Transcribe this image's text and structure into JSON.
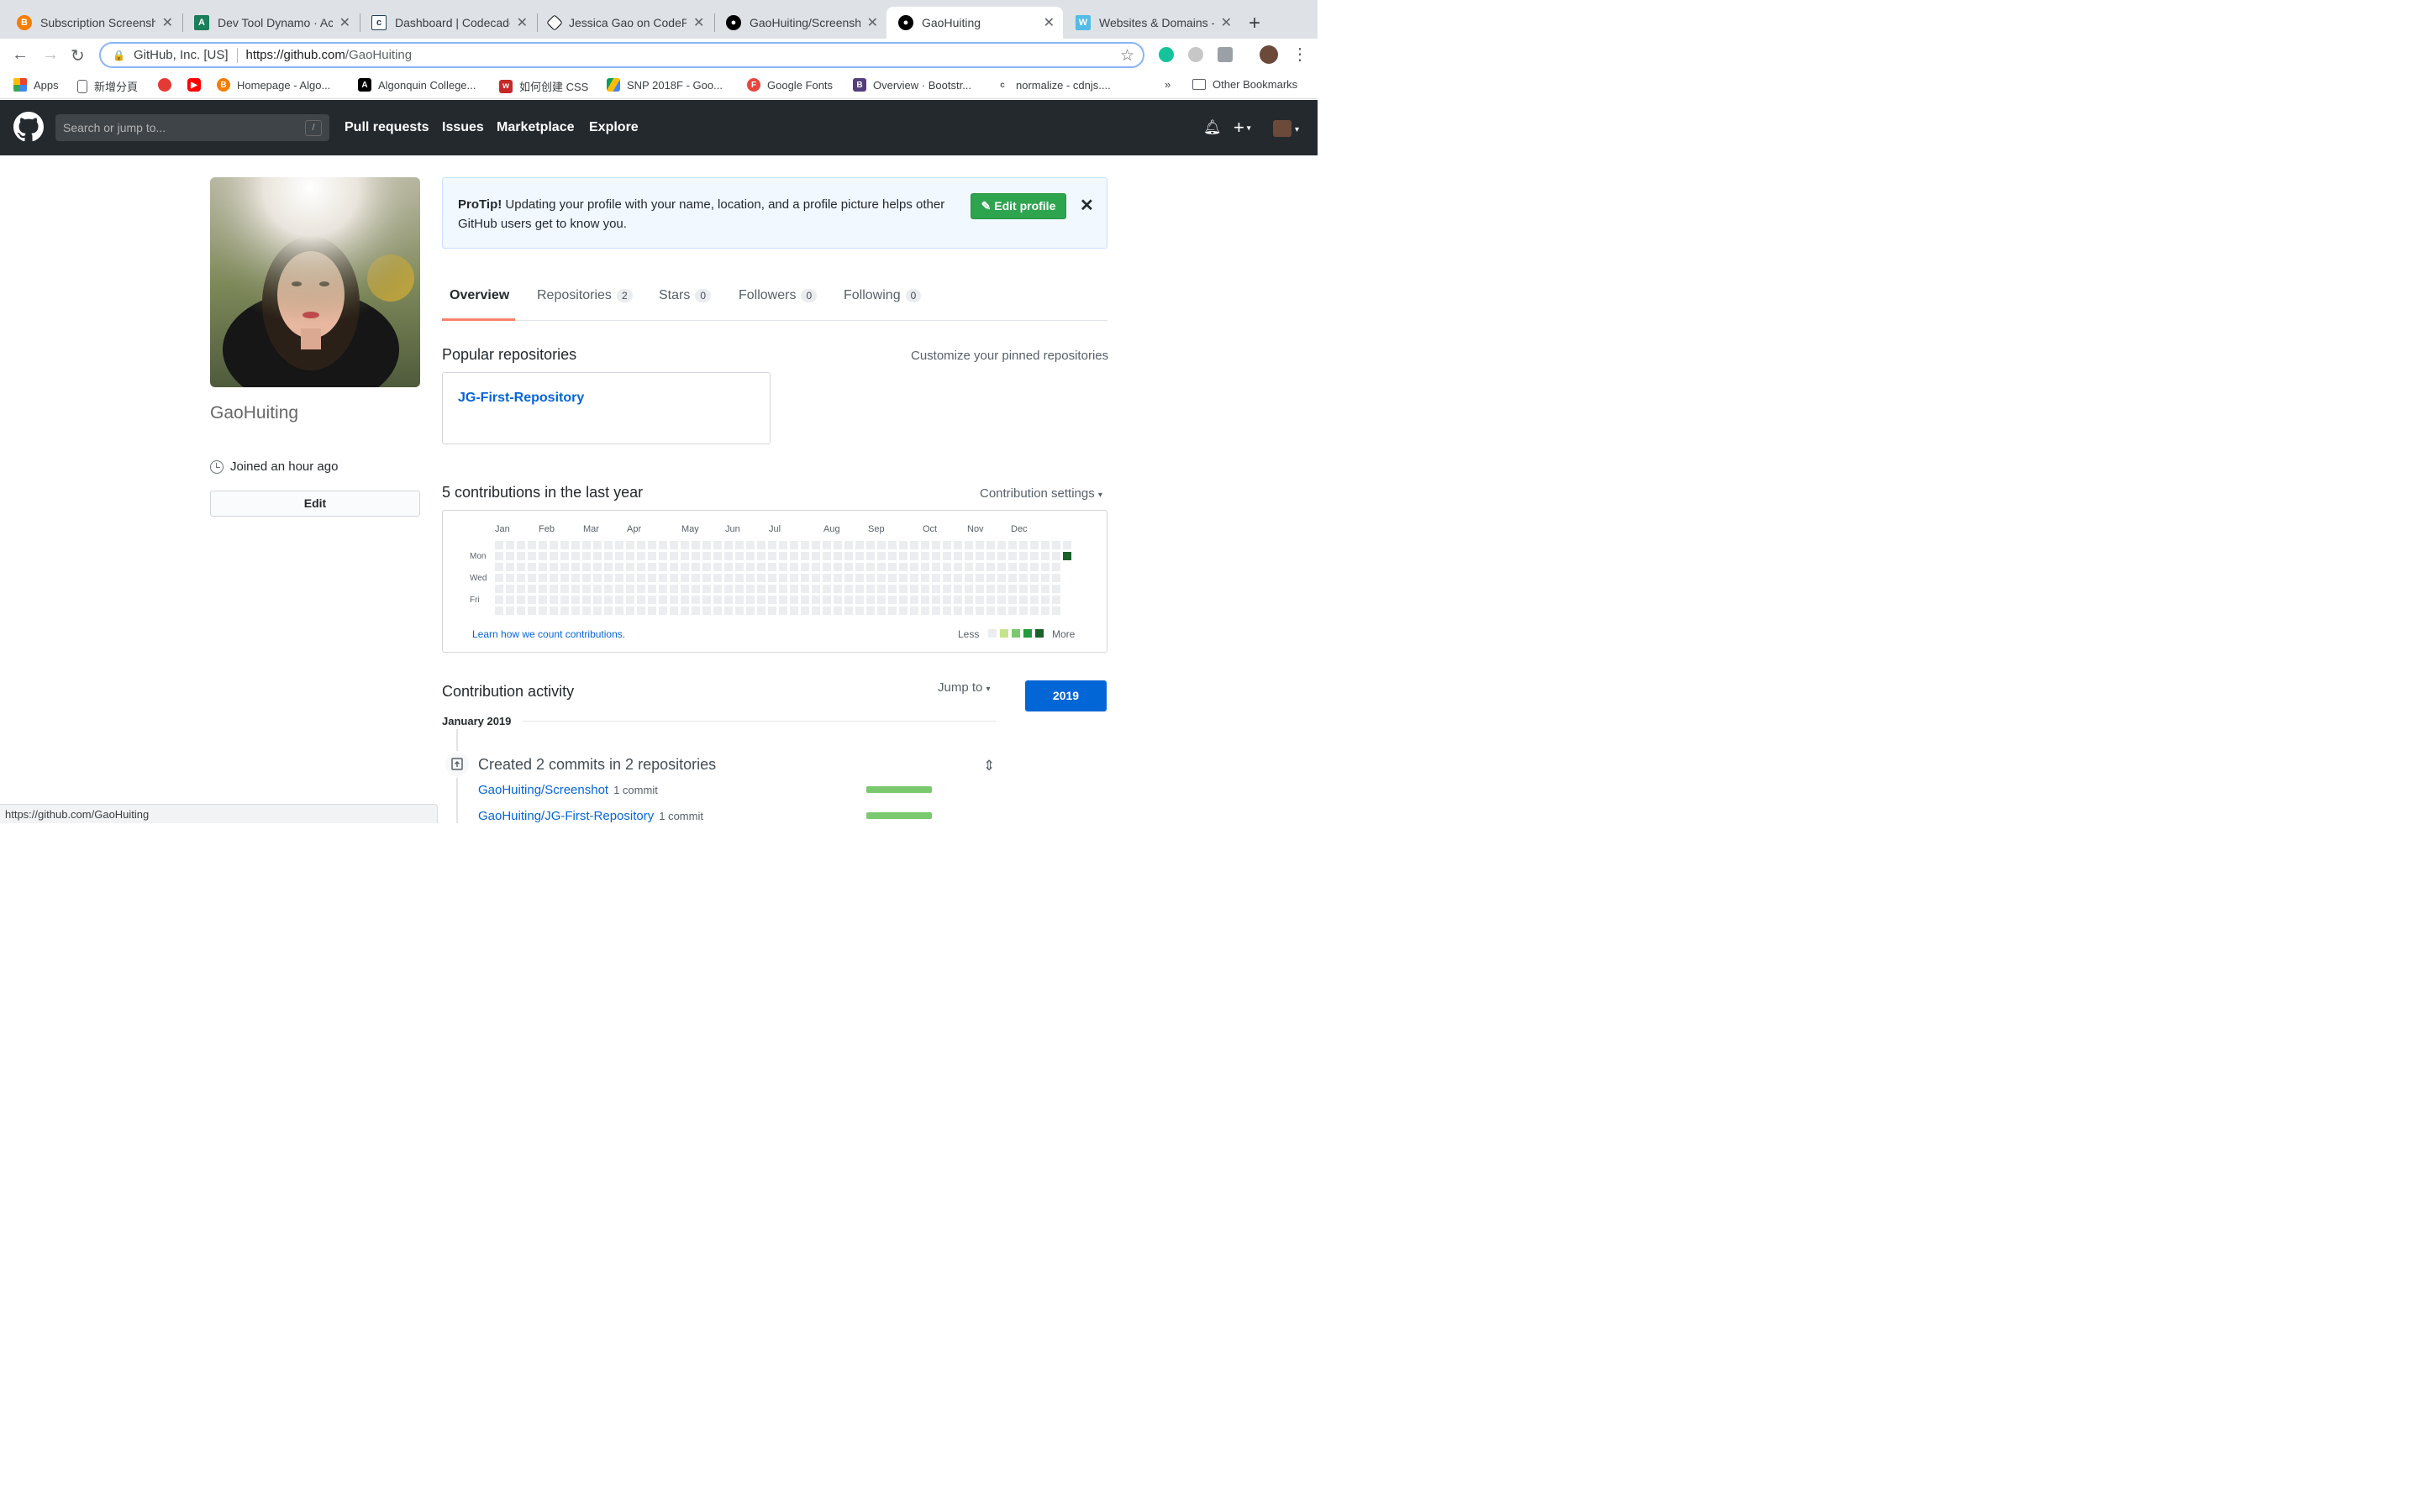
{
  "browser": {
    "tabs": [
      {
        "title": "Subscription Screensh",
        "icon": "blogger-icon",
        "color": "#f57d00"
      },
      {
        "title": "Dev Tool Dynamo · Act",
        "icon": "chart-icon",
        "color": "#1a7f5a"
      },
      {
        "title": "Dashboard | Codecade",
        "icon": "codecademy-icon",
        "color": "#204056"
      },
      {
        "title": "Jessica Gao on CodeP",
        "icon": "codepen-icon",
        "color": "#000000"
      },
      {
        "title": "GaoHuiting/Screensho",
        "icon": "github-icon",
        "color": "#000000"
      },
      {
        "title": "GaoHuiting",
        "icon": "github-icon",
        "color": "#000000",
        "active": true
      },
      {
        "title": "Websites & Domains -",
        "icon": "plesk-icon",
        "color": "#52bbe6"
      }
    ],
    "address": {
      "org": "GitHub, Inc. [US]",
      "url_host": "https://github.com",
      "url_path": "/GaoHuiting"
    },
    "bookmarks": [
      {
        "label": "Apps",
        "icon": "apps-grid-icon"
      },
      {
        "label": "新增分頁",
        "icon": "page-icon"
      },
      {
        "label": "",
        "icon": "kiwi-icon"
      },
      {
        "label": "",
        "icon": "youtube-icon"
      },
      {
        "label": "Homepage - Algo...",
        "icon": "blogger-icon"
      },
      {
        "label": "Algonquin College...",
        "icon": "algonquin-icon"
      },
      {
        "label": "如何创建 CSS",
        "icon": "w3-icon"
      },
      {
        "label": "SNP 2018F - Goo...",
        "icon": "drive-icon"
      },
      {
        "label": "Google Fonts",
        "icon": "fonts-icon"
      },
      {
        "label": "Overview · Bootstr...",
        "icon": "bootstrap-icon"
      },
      {
        "label": "normalize - cdnjs....",
        "icon": "cdnjs-icon"
      },
      {
        "label": "»",
        "icon": ""
      },
      {
        "label": "Other Bookmarks",
        "icon": "folder-icon"
      }
    ],
    "status_url": "https://github.com/GaoHuiting"
  },
  "github": {
    "search_placeholder": "Search or jump to...",
    "search_key": "/",
    "nav": [
      "Pull requests",
      "Issues",
      "Marketplace",
      "Explore"
    ]
  },
  "profile": {
    "username": "GaoHuiting",
    "joined": "Joined an hour ago",
    "edit_label": "Edit"
  },
  "protip": {
    "strong": "ProTip!",
    "text": " Updating your profile with your name, location, and a profile picture helps other GitHub users get to know you.",
    "button": "Edit profile"
  },
  "tabs": [
    {
      "label": "Overview",
      "count": null,
      "active": true
    },
    {
      "label": "Repositories",
      "count": "2"
    },
    {
      "label": "Stars",
      "count": "0"
    },
    {
      "label": "Followers",
      "count": "0"
    },
    {
      "label": "Following",
      "count": "0"
    }
  ],
  "popular": {
    "title": "Popular repositories",
    "customize": "Customize your pinned repositories",
    "repos": [
      "JG-First-Repository"
    ]
  },
  "contributions": {
    "title": "5 contributions in the last year",
    "settings": "Contribution settings",
    "months": [
      "Jan",
      "Feb",
      "Mar",
      "Apr",
      "May",
      "Jun",
      "Jul",
      "Aug",
      "Sep",
      "Oct",
      "Nov",
      "Dec"
    ],
    "days": [
      "Mon",
      "Wed",
      "Fri"
    ],
    "learn": "Learn how we count contributions.",
    "less": "Less",
    "more": "More",
    "colors": [
      "#ebedf0",
      "#c6e48b",
      "#7bc96f",
      "#239a3b",
      "#196127"
    ]
  },
  "activity": {
    "title": "Contribution activity",
    "jump_to": "Jump to",
    "year": "2019",
    "month": "January 2019",
    "summary": "Created 2 commits in 2 repositories",
    "rows": [
      {
        "repo": "GaoHuiting/Screenshot",
        "count": "1 commit"
      },
      {
        "repo": "GaoHuiting/JG-First-Repository",
        "count": "1 commit"
      }
    ]
  }
}
